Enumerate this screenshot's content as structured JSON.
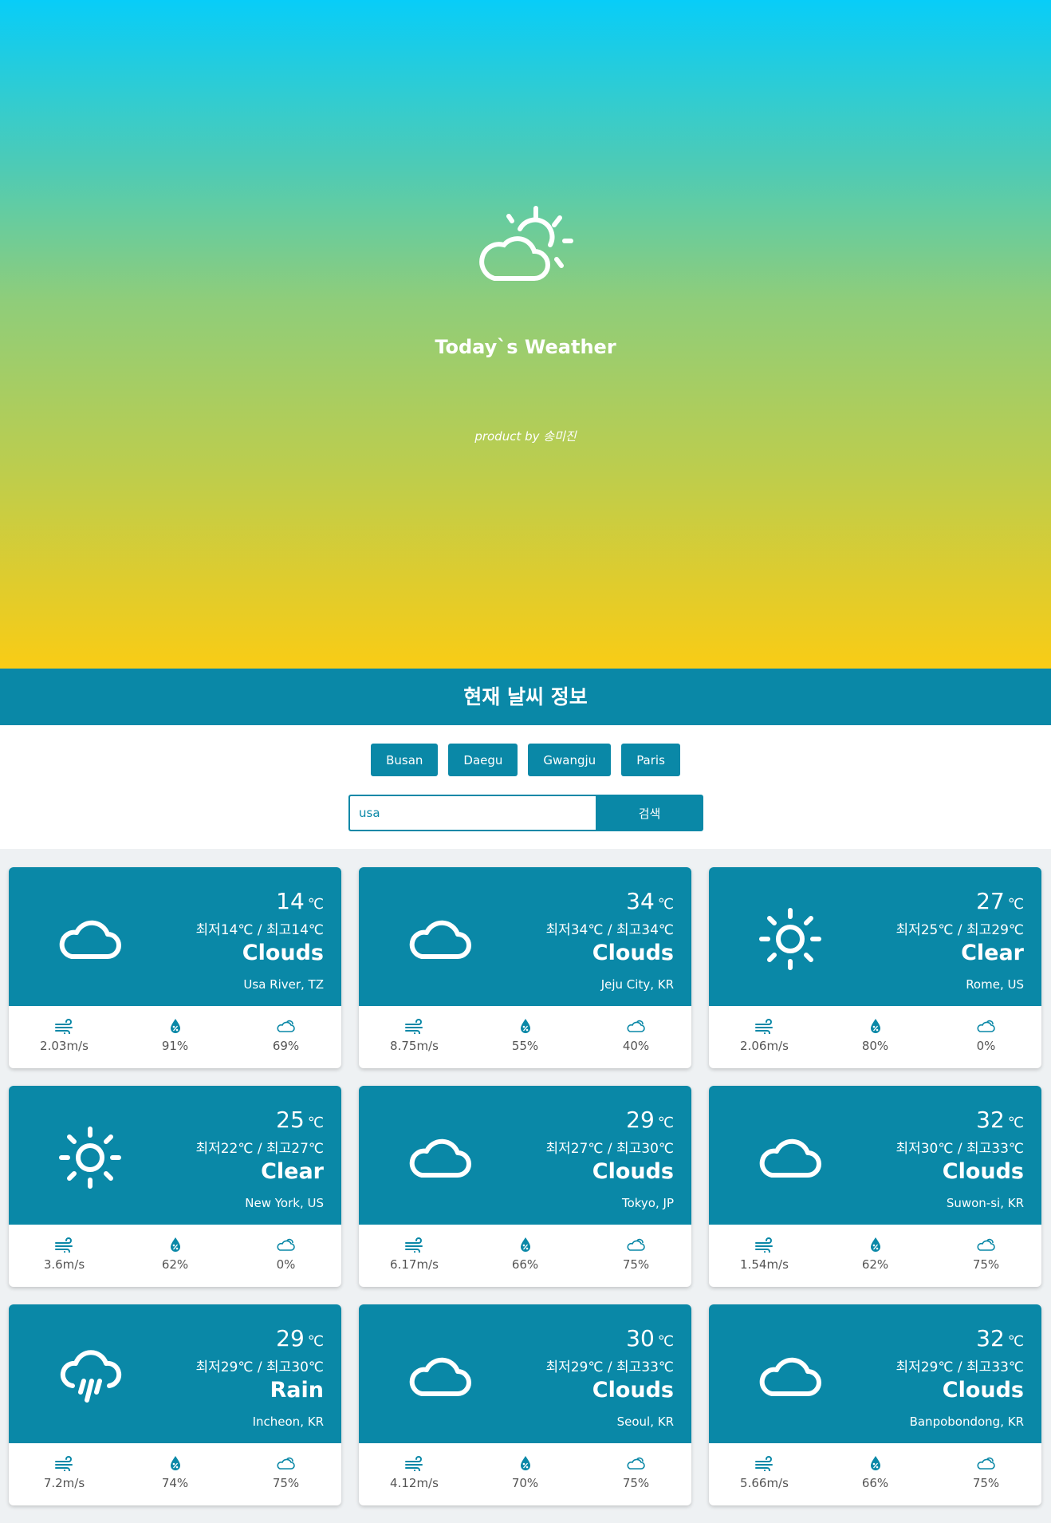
{
  "hero": {
    "title": "Today`s Weather",
    "credit": "product by 송미진",
    "icon": "partly-sunny-icon",
    "gradient": [
      "#08cdf8",
      "#f9cc15"
    ]
  },
  "section": {
    "title": "현재 날씨 정보"
  },
  "cities": [
    "Busan",
    "Daegu",
    "Gwangju",
    "Paris"
  ],
  "search": {
    "value": "usa",
    "button_label": "검색"
  },
  "accent_color": "#0a88a7",
  "temp_unit": "℃",
  "cards": [
    {
      "temp": "14",
      "range": "최저14℃ / 최고14℃",
      "desc": "Clouds",
      "location": "Usa River, TZ",
      "icon": "cloud-icon",
      "wind": "2.03m/s",
      "humidity": "91%",
      "cloudiness": "69%"
    },
    {
      "temp": "34",
      "range": "최저34℃ / 최고34℃",
      "desc": "Clouds",
      "location": "Jeju City, KR",
      "icon": "cloud-icon",
      "wind": "8.75m/s",
      "humidity": "55%",
      "cloudiness": "40%"
    },
    {
      "temp": "27",
      "range": "최저25℃ / 최고29℃",
      "desc": "Clear",
      "location": "Rome, US",
      "icon": "sun-icon",
      "wind": "2.06m/s",
      "humidity": "80%",
      "cloudiness": "0%"
    },
    {
      "temp": "25",
      "range": "최저22℃ / 최고27℃",
      "desc": "Clear",
      "location": "New York, US",
      "icon": "sun-icon",
      "wind": "3.6m/s",
      "humidity": "62%",
      "cloudiness": "0%"
    },
    {
      "temp": "29",
      "range": "최저27℃ / 최고30℃",
      "desc": "Clouds",
      "location": "Tokyo, JP",
      "icon": "cloud-icon",
      "wind": "6.17m/s",
      "humidity": "66%",
      "cloudiness": "75%"
    },
    {
      "temp": "32",
      "range": "최저30℃ / 최고33℃",
      "desc": "Clouds",
      "location": "Suwon-si, KR",
      "icon": "cloud-icon",
      "wind": "1.54m/s",
      "humidity": "62%",
      "cloudiness": "75%"
    },
    {
      "temp": "29",
      "range": "최저29℃ / 최고30℃",
      "desc": "Rain",
      "location": "Incheon, KR",
      "icon": "rain-icon",
      "wind": "7.2m/s",
      "humidity": "74%",
      "cloudiness": "75%"
    },
    {
      "temp": "30",
      "range": "최저29℃ / 최고33℃",
      "desc": "Clouds",
      "location": "Seoul, KR",
      "icon": "cloud-icon",
      "wind": "4.12m/s",
      "humidity": "70%",
      "cloudiness": "75%"
    },
    {
      "temp": "32",
      "range": "최저29℃ / 최고33℃",
      "desc": "Clouds",
      "location": "Banpobondong, KR",
      "icon": "cloud-icon",
      "wind": "5.66m/s",
      "humidity": "66%",
      "cloudiness": "75%"
    }
  ]
}
